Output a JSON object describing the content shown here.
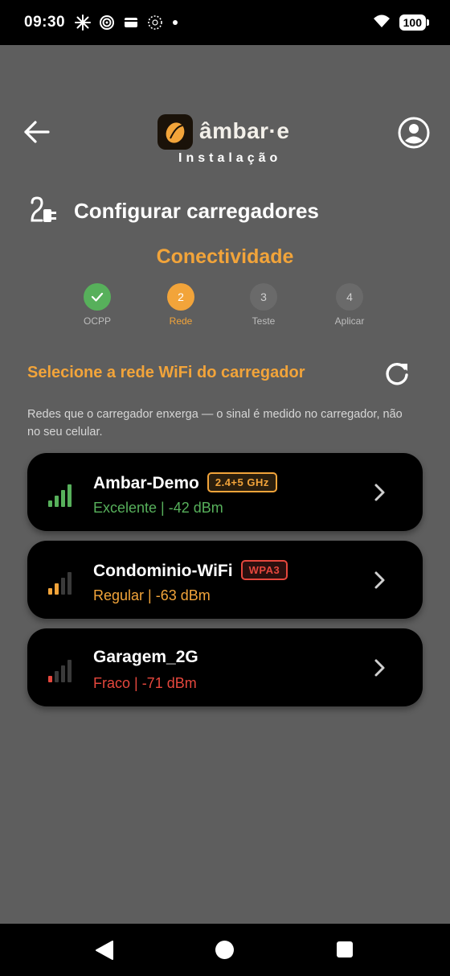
{
  "status_bar": {
    "time": "09:30",
    "battery": "100",
    "icons": [
      "pinwheel-icon",
      "spiral-icon",
      "wallet-icon",
      "dotted-circle-icon",
      "dot-icon",
      "wifi-icon",
      "battery-icon"
    ]
  },
  "header": {
    "app_name": "âmbar·e",
    "subtitle": "Instalação",
    "back_icon": "back-arrow-icon",
    "profile_icon": "account-circle-icon"
  },
  "page": {
    "title": "Configurar carregadores",
    "title_icon": "charger-plug-icon",
    "step_title": "Conectividade"
  },
  "stepper": {
    "steps": [
      {
        "num": "1",
        "label": "OCPP",
        "state": "done"
      },
      {
        "num": "2",
        "label": "Rede",
        "state": "active"
      },
      {
        "num": "3",
        "label": "Teste",
        "state": "idle"
      },
      {
        "num": "4",
        "label": "Aplicar",
        "state": "idle"
      }
    ]
  },
  "section": {
    "title": "Selecione a rede WiFi do carregador",
    "hint": "Redes que o carregador enxerga — o sinal é medido no carregador, não no seu celular."
  },
  "networks": [
    {
      "name": "Ambar-Demo",
      "badge": "2.4+5 GHz",
      "status": "Excelente  |  -42 dBm",
      "quality": "excellent",
      "bars": 4,
      "color": "#57b05b"
    },
    {
      "name": "Condominio-WiFi",
      "badge": "WPA3",
      "status": "Regular  |  -63 dBm",
      "quality": "regular",
      "bars": 2,
      "color": "#f2a43a"
    },
    {
      "name": "Garagem_2G",
      "badge": "",
      "status": "Fraco  |  -71 dBm",
      "quality": "weak",
      "bars": 1,
      "color": "#e5473d"
    }
  ],
  "colors": {
    "accent": "#f2a43a",
    "success": "#57b05b",
    "danger": "#e5473d",
    "background": "#5e5e5e",
    "card": "#000000"
  }
}
